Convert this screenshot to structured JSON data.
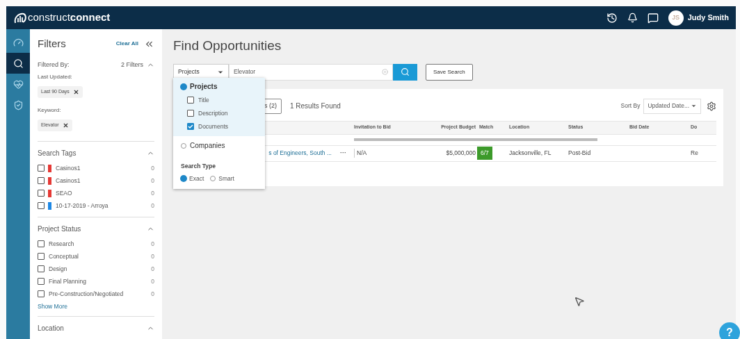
{
  "header": {
    "logo": "construct**connect**",
    "user": {
      "initials": "JS",
      "name": "Judy Smith"
    }
  },
  "rail": [
    {
      "selected": false
    },
    {
      "selected": true
    },
    {
      "selected": false
    },
    {
      "selected": false
    }
  ],
  "filters": {
    "title": "Filters",
    "clear_all": "Clear All",
    "filtered_by": {
      "label": "Filtered By:",
      "count": "2 Filters",
      "groups": [
        {
          "label": "Last Updated:",
          "chip": "Last 90 Days"
        },
        {
          "label": "Keyword:",
          "chip": "Elevator"
        }
      ]
    },
    "sections": [
      {
        "title": "Search Tags",
        "items": [
          {
            "label": "Casinos1",
            "count": "0",
            "checked": false,
            "color": "#e53935"
          },
          {
            "label": "Casinos1",
            "count": "0",
            "checked": false,
            "color": "#e53935"
          },
          {
            "label": "SEAO",
            "count": "0",
            "checked": false,
            "color": "#e53935"
          },
          {
            "label": "10-17-2019 - Arroya",
            "count": "0",
            "checked": false,
            "color": "#1e88e5"
          }
        ]
      },
      {
        "title": "Project Status",
        "items": [
          {
            "label": "Research",
            "count": "0",
            "checked": false
          },
          {
            "label": "Conceptual",
            "count": "0",
            "checked": false
          },
          {
            "label": "Design",
            "count": "0",
            "checked": false
          },
          {
            "label": "Final Planning",
            "count": "0",
            "checked": false
          },
          {
            "label": "Pre-Construction/Negotiated",
            "count": "0",
            "checked": false
          }
        ],
        "show_more": "Show More"
      },
      {
        "title": "Location"
      }
    ]
  },
  "main": {
    "title": "Find Opportunities",
    "search": {
      "scope": "Projects",
      "value": "Elevator",
      "save": "Save Search"
    },
    "tab_fragment": "s (2)",
    "results": "1 Results Found",
    "sort_label": "Sort By",
    "sort_value": "Updated Date...",
    "table": {
      "columns": [
        "Invitation to Bid",
        "Project Budget",
        "Match",
        "Location",
        "Status",
        "Bid Date",
        "Do"
      ],
      "rows": [
        {
          "title": "s of Engineers, South ...",
          "more": "···",
          "cells": [
            "N/A",
            "$5,000,000",
            "6/7",
            "Jacksonville, FL",
            "Post-Bid",
            "",
            "Re"
          ]
        }
      ]
    }
  },
  "dropdown": {
    "options": [
      {
        "kind": "radio",
        "label": "Projects",
        "selected": true,
        "children": [
          {
            "label": "Title",
            "checked": false
          },
          {
            "label": "Description",
            "checked": false
          },
          {
            "label": "Documents",
            "checked": true
          }
        ]
      },
      {
        "kind": "radio",
        "label": "Companies",
        "selected": false
      }
    ],
    "search_type": {
      "label": "Search Type",
      "options": [
        {
          "label": "Exact",
          "selected": true
        },
        {
          "label": "Smart",
          "selected": false
        }
      ]
    }
  },
  "help": "?"
}
